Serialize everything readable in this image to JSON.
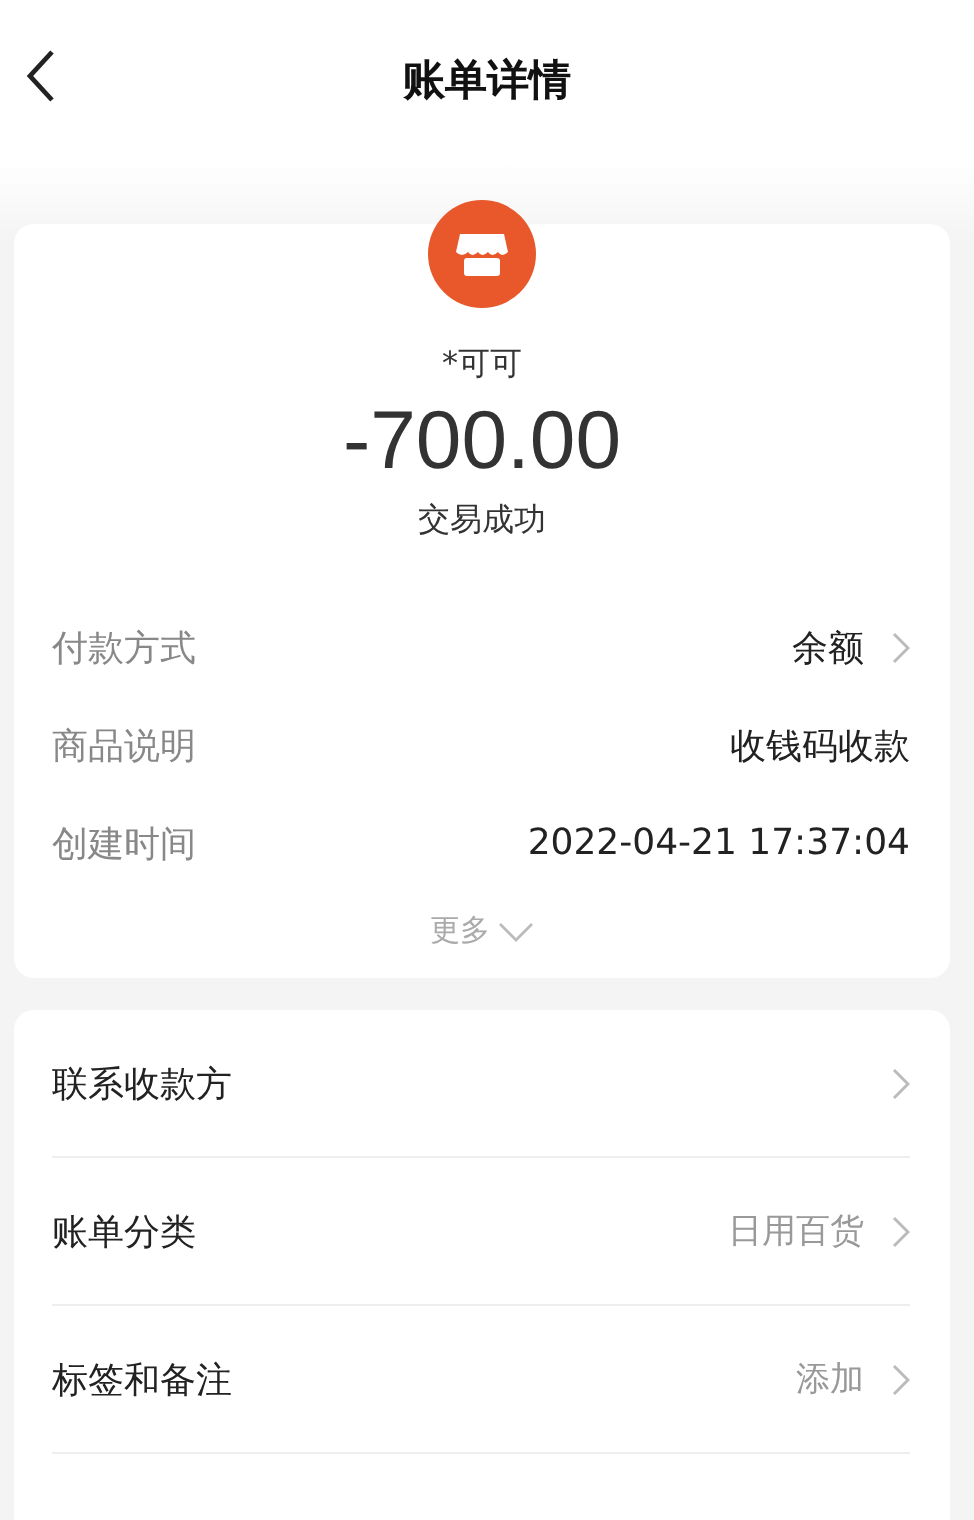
{
  "header": {
    "title": "账单详情"
  },
  "summary": {
    "counterparty": "*可可",
    "amount": "-700.00",
    "status": "交易成功"
  },
  "details": [
    {
      "label": "付款方式",
      "value": "余额",
      "arrow": true
    },
    {
      "label": "商品说明",
      "value": "收钱码收款",
      "arrow": false
    },
    {
      "label": "创建时间",
      "value": "2022-04-21 17:37:04",
      "arrow": false
    }
  ],
  "more": {
    "label": "更多",
    "expanded": false
  },
  "actions": [
    {
      "label": "联系收款方"
    },
    {
      "label": "账单分类",
      "value": "日用百货"
    },
    {
      "label": "标签和备注",
      "value": "添加"
    }
  ]
}
